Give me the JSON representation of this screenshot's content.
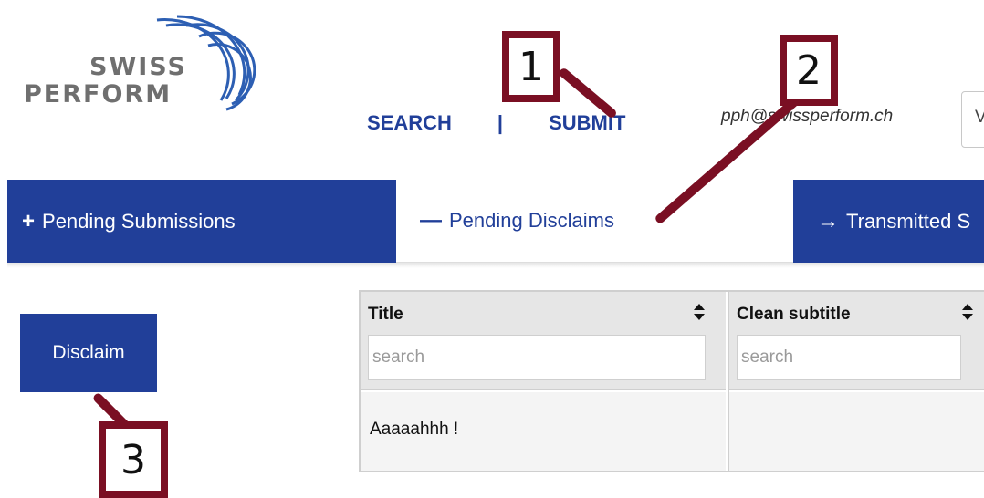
{
  "logo": {
    "line1": "SWISS",
    "line2": "PERFORM"
  },
  "topnav": {
    "search_label": "SEARCH",
    "separator": "|",
    "submit_label": "SUBMIT"
  },
  "user": {
    "email": "pph@swissperform.ch",
    "select_value": "V"
  },
  "tabs": [
    {
      "icon": "+",
      "label": "Pending Submissions"
    },
    {
      "icon": "—",
      "label": "Pending Disclaims"
    },
    {
      "icon": "→",
      "label": "Transmitted S"
    }
  ],
  "actions": {
    "disclaim_label": "Disclaim"
  },
  "table": {
    "columns": [
      {
        "header": "Title",
        "search_placeholder": "search"
      },
      {
        "header": "Clean subtitle",
        "search_placeholder": "search"
      }
    ],
    "rows": [
      {
        "title": "Aaaaahhh !",
        "clean_subtitle": ""
      }
    ]
  },
  "annotations": {
    "one": "1",
    "two": "2",
    "three": "3"
  },
  "colors": {
    "brand_blue": "#213f99",
    "annotation": "#7a0f23",
    "logo_gray": "#6f6f6f"
  }
}
